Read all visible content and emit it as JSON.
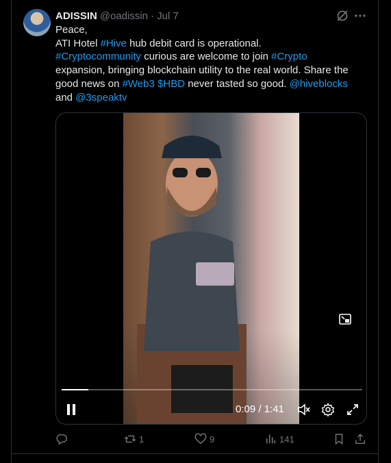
{
  "tweet": {
    "display_name": "ADISSIN",
    "handle": "@oadissin",
    "separator": "·",
    "date": "Jul 7",
    "text_lines": [
      [
        {
          "t": "Peace,",
          "link": false
        }
      ],
      [
        {
          "t": "ATI Hotel ",
          "link": false
        },
        {
          "t": "#Hive",
          "link": true
        },
        {
          "t": " hub debit card is operational.",
          "link": false
        }
      ],
      [
        {
          "t": "#Cryptocommunity",
          "link": true
        },
        {
          "t": " curious are welcome  to join  ",
          "link": false
        },
        {
          "t": "#Crypto",
          "link": true
        }
      ],
      [
        {
          "t": "expansion, bringing blockchain utility to the real world. Share the",
          "link": false
        }
      ],
      [
        {
          "t": "good news on ",
          "link": false
        },
        {
          "t": "#Web3",
          "link": true
        },
        {
          "t": " ",
          "link": false
        },
        {
          "t": "$HBD",
          "link": true
        },
        {
          "t": " never tasted so good. ",
          "link": false
        },
        {
          "t": "@hiveblocks",
          "link": true
        }
      ],
      [
        {
          "t": "and ",
          "link": false
        },
        {
          "t": "@3speaktv",
          "link": true
        }
      ]
    ]
  },
  "video": {
    "current_time": "0:09",
    "duration": "1:41",
    "progress_fraction": 0.089,
    "time_label": "0:09 / 1:41"
  },
  "actions": {
    "reply_count": "",
    "retweet_count": "1",
    "like_count": "9",
    "views_count": "141"
  },
  "icons": {
    "grok": "grok-icon",
    "more": "more-icon",
    "pip": "picture-in-picture-icon",
    "pause": "pause-icon",
    "mute": "mute-icon",
    "settings": "settings-icon",
    "fullscreen": "fullscreen-icon",
    "reply": "reply-icon",
    "retweet": "retweet-icon",
    "like": "like-icon",
    "views": "views-icon",
    "bookmark": "bookmark-icon",
    "share": "share-icon"
  },
  "colors": {
    "background": "#000000",
    "text": "#e7e9ea",
    "secondary": "#71767b",
    "link": "#1d9bf0",
    "border": "#2f3336"
  }
}
